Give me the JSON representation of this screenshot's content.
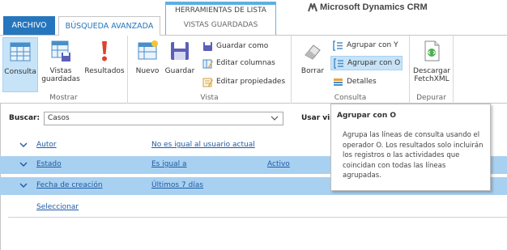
{
  "tabs": {
    "file": "ARCHIVO",
    "advanced_find": "BÚSQUEDA AVANZADA",
    "context_group": "HERRAMIENTAS DE LISTA",
    "context_tab": "VISTAS GUARDADAS"
  },
  "brand": "Microsoft Dynamics CRM",
  "ribbon": {
    "mostrar": {
      "label": "Mostrar",
      "consulta": "Consulta",
      "vistas_guardadas_l1": "Vistas",
      "vistas_guardadas_l2": "guardadas",
      "resultados": "Resultados"
    },
    "vista": {
      "label": "Vista",
      "nuevo": "Nuevo",
      "guardar": "Guardar",
      "guardar_como": "Guardar como",
      "editar_columnas": "Editar columnas",
      "editar_propiedades": "Editar propiedades"
    },
    "consulta": {
      "label": "Consulta",
      "borrar": "Borrar",
      "agrupar_y": "Agrupar con Y",
      "agrupar_o": "Agrupar con O",
      "detalles": "Detalles"
    },
    "depurar": {
      "label": "Depurar",
      "descargar_l1": "Descargar",
      "descargar_l2": "FetchXML"
    }
  },
  "search": {
    "label": "Buscar:",
    "value": "Casos",
    "usar_label": "Usar vis"
  },
  "criteria": [
    {
      "field": "Autor",
      "operator": "No es igual al usuario actual",
      "value": "",
      "selected": false
    },
    {
      "field": "Estado",
      "operator": "Es igual a",
      "value": "Activo",
      "selected": true
    },
    {
      "field": "Fecha de creación",
      "operator": "Últimos 7 días",
      "value": "",
      "selected": true
    }
  ],
  "select_link": "Seleccionar",
  "tooltip": {
    "title": "Agrupar con O",
    "body": "Agrupa las líneas de consulta usando el operador O. Los resultados solo incluirán los registros o las actividades que coincidan con todas las líneas agrupadas."
  },
  "colors": {
    "accent": "#2576bd",
    "selected_row": "#a8d0f0",
    "link": "#1f5aa6"
  }
}
